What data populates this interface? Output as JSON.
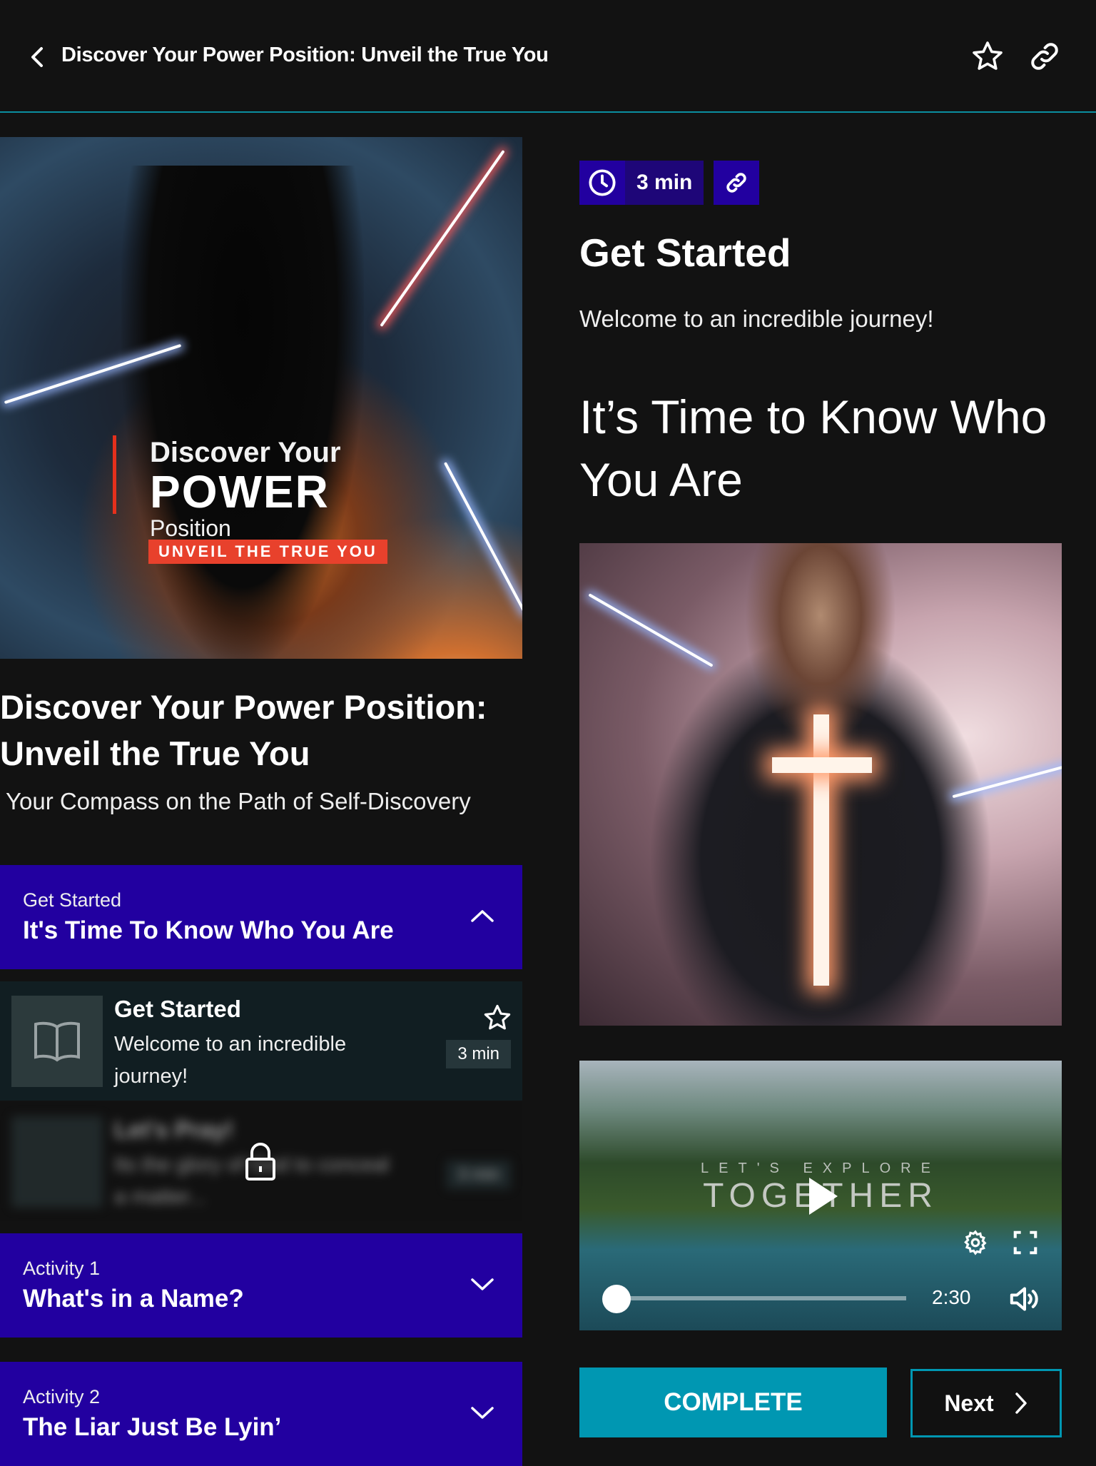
{
  "header": {
    "title": "Discover Your Power Position: Unveil the True You",
    "back_icon": "chevron-left-icon",
    "favorite_icon": "star-icon",
    "share_icon": "link-icon"
  },
  "course": {
    "cover_art": {
      "line1": "Discover Your",
      "line2": "POWER",
      "line3": "Position",
      "tagline": "UNVEIL THE TRUE YOU"
    },
    "title": "Discover Your Power Position: Unveil the True You",
    "subtitle": "Your Compass on the Path of Self-Discovery"
  },
  "sections": [
    {
      "label": "Get Started",
      "title": "It's Time To Know Who You Are",
      "expanded": true,
      "items": [
        {
          "title": "Get Started",
          "description": "Welcome to an incredible journey!",
          "duration": "3 min",
          "locked": false
        },
        {
          "title": "Let's Pray!",
          "description": "Its the glory of God to conceal a matter...",
          "duration": "3 min",
          "locked": true
        }
      ]
    },
    {
      "label": "Activity 1",
      "title": "What's in a Name?",
      "expanded": false
    },
    {
      "label": "Activity 2",
      "title": "The Liar Just Be Lyin’",
      "expanded": false
    }
  ],
  "lesson": {
    "duration": "3 min",
    "title": "Get Started",
    "intro": "Welcome to an incredible journey!",
    "heading": "It’s Time to Know Who You Are",
    "video": {
      "overlay_line1": "LET'S EXPLORE",
      "overlay_line2": "TOGETHER",
      "duration": "2:30",
      "progress": 0
    }
  },
  "actions": {
    "complete": "COMPLETE",
    "next": "Next"
  },
  "colors": {
    "background": "#121212",
    "section": "#2200a0",
    "accent": "#0097b2",
    "card": "#111e22"
  }
}
